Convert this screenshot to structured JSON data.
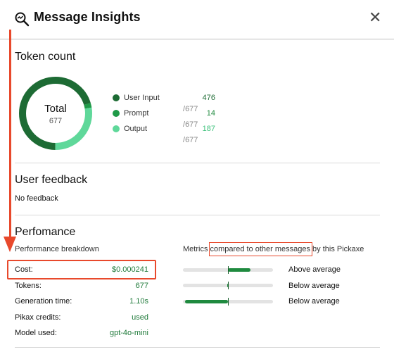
{
  "header": {
    "title": "Message Insights",
    "close_symbol": "✕"
  },
  "token_count": {
    "title": "Token count",
    "center_label": "Total",
    "center_value": "677",
    "total": 677,
    "legend": [
      {
        "label": "User Input",
        "value": "476",
        "total": "677",
        "color": "#1d6b34"
      },
      {
        "label": "Prompt",
        "value": "14",
        "total": "677",
        "color": "#1f9a48"
      },
      {
        "label": "Output",
        "value": "187",
        "total": "677",
        "color": "#5fd89a"
      }
    ],
    "sep": "/"
  },
  "feedback": {
    "title": "User feedback",
    "text": "No feedback"
  },
  "performance": {
    "title": "Perfomance",
    "breakdown_label": "Performance breakdown",
    "metrics_prefix": "Metrics",
    "metrics_highlight": "compared to other messages",
    "metrics_suffix": "by this Pickaxe",
    "rows": [
      {
        "key": "Cost:",
        "value": "$0.000241"
      },
      {
        "key": "Tokens:",
        "value": "677"
      },
      {
        "key": "Generation time:",
        "value": "1.10s"
      },
      {
        "key": "Pikax credits:",
        "value": "used"
      },
      {
        "key": "Model used:",
        "value": "gpt-4o-mini"
      }
    ],
    "metrics": [
      {
        "label": "Above average",
        "fill_start": 0.5,
        "fill_end": 0.75
      },
      {
        "label": "Below average",
        "fill_start": 0.49,
        "fill_end": 0.5
      },
      {
        "label": "Below average",
        "fill_start": 0.02,
        "fill_end": 0.5
      }
    ]
  },
  "colors": {
    "accent_green": "#1f7a3a",
    "annotation_red": "#e8492c"
  }
}
